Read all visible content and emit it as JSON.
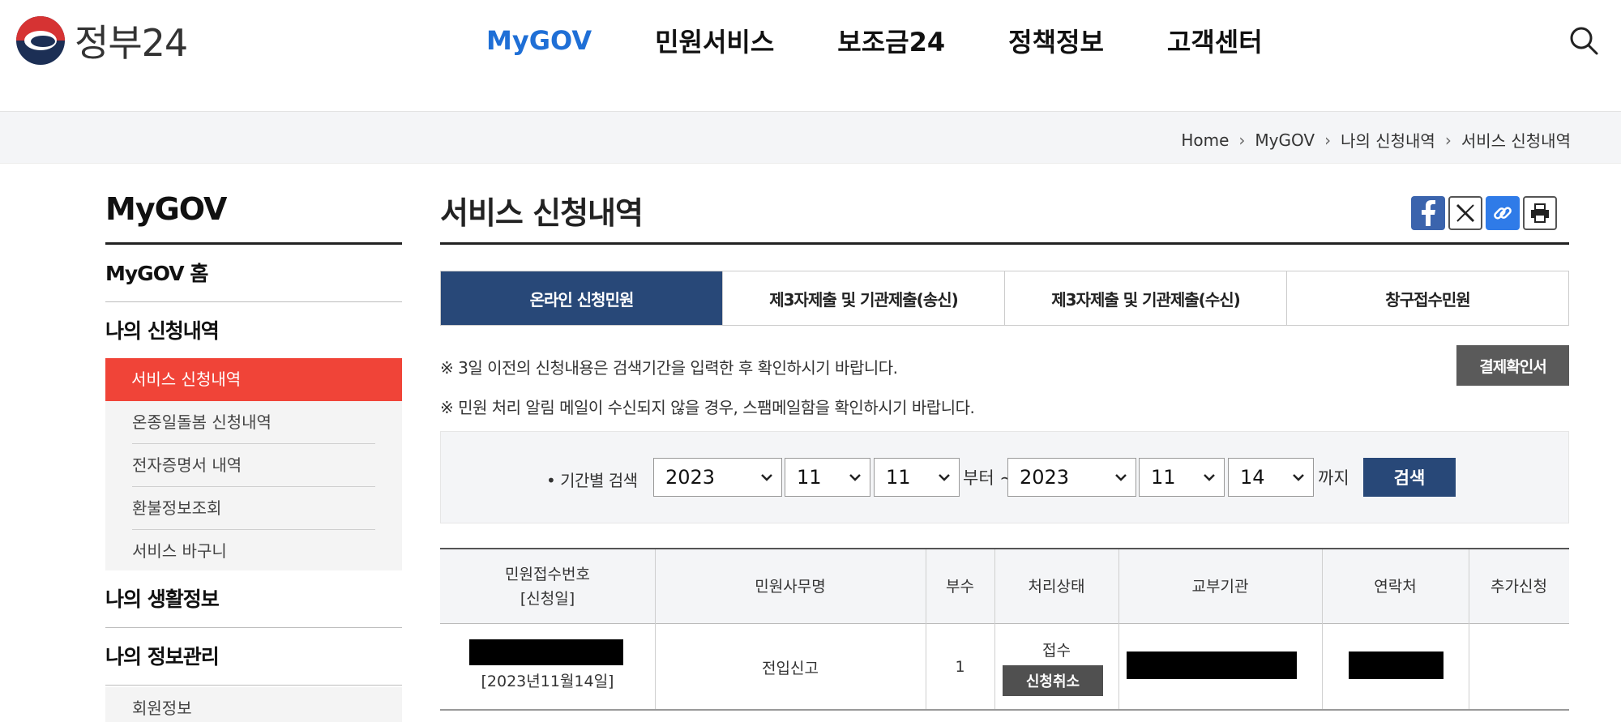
{
  "header": {
    "logo_text": "정부24",
    "nav": [
      "MyGOV",
      "민원서비스",
      "보조금24",
      "정책정보",
      "고객센터"
    ],
    "active_nav": "MyGOV",
    "search_icon": "search-icon"
  },
  "breadcrumb": [
    "Home",
    "MyGOV",
    "나의 신청내역",
    "서비스 신청내역"
  ],
  "sidebar": {
    "title": "MyGOV",
    "home": "MyGOV 홈",
    "section_apply": "나의 신청내역",
    "sub_items": [
      "서비스 신청내역",
      "온종일돌봄 신청내역",
      "전자증명서 내역",
      "환불정보조회",
      "서비스 바구니"
    ],
    "section_life": "나의 생활정보",
    "section_info": "나의 정보관리",
    "member": "회원정보"
  },
  "main": {
    "title": "서비스 신청내역",
    "share_icons": [
      "facebook-icon",
      "x-icon",
      "link-icon",
      "print-icon"
    ],
    "tabs": [
      "온라인 신청민원",
      "제3자제출 및 기관제출(송신)",
      "제3자제출 및 기관제출(수신)",
      "창구접수민원"
    ],
    "active_tab": 0,
    "notice1": "※ 3일 이전의 신청내용은 검색기간을 입력한 후 확인하시기 바랍니다.",
    "notice2": "※ 민원 처리 알림 메일이 수신되지 않을 경우, 스팸메일함을 확인하시기 바랍니다.",
    "receipt_button": "결제확인서"
  },
  "search": {
    "label": "• 기간별 검색",
    "from_year": "2023",
    "from_month": "11",
    "from_day": "11",
    "from_suffix": "부터 ~",
    "to_year": "2023",
    "to_month": "11",
    "to_day": "14",
    "to_suffix": "까지",
    "button": "검색"
  },
  "table": {
    "headers": [
      "민원접수번호",
      "[신청일]",
      "민원사무명",
      "부수",
      "처리상태",
      "교부기관",
      "연락처",
      "추가신청"
    ],
    "rows": [
      {
        "receipt_number": "[redacted]",
        "apply_date": "[2023년11월14일]",
        "service_name": "전입신고",
        "copies": "1",
        "status": "접수",
        "cancel_button": "신청취소",
        "agency": "[redacted]",
        "contact": "[redacted]",
        "extra": ""
      }
    ],
    "colors": {
      "active_tab": "#284878",
      "sidebar_active": "#f04438",
      "nav_active": "#1f6fd6"
    }
  }
}
